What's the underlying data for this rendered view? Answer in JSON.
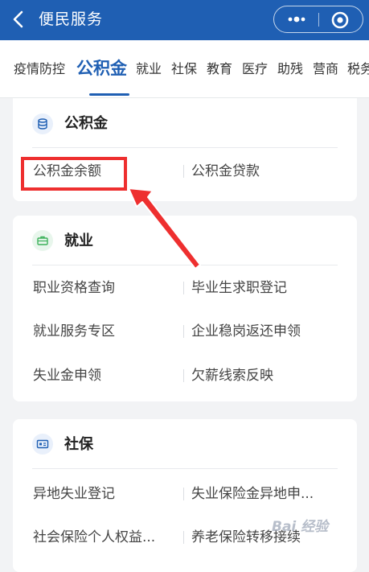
{
  "header": {
    "title": "便民服务",
    "color": "#1f5fb3"
  },
  "tabs": [
    {
      "label": "疫情防控",
      "active": false
    },
    {
      "label": "公积金",
      "active": true
    },
    {
      "label": "就业",
      "active": false
    },
    {
      "label": "社保",
      "active": false
    },
    {
      "label": "教育",
      "active": false
    },
    {
      "label": "医疗",
      "active": false
    },
    {
      "label": "助残",
      "active": false
    },
    {
      "label": "营商",
      "active": false
    },
    {
      "label": "税务",
      "active": false
    }
  ],
  "sections": [
    {
      "title": "公积金",
      "icon": "database-icon",
      "icon_color": "#1f5fb3",
      "items": [
        "公积金余额",
        "公积金贷款"
      ]
    },
    {
      "title": "就业",
      "icon": "briefcase-icon",
      "icon_color": "#3cb15a",
      "items": [
        "职业资格查询",
        "毕业生求职登记",
        "就业服务专区",
        "企业稳岗返还申领",
        "失业金申领",
        "欠薪线索反映"
      ]
    },
    {
      "title": "社保",
      "icon": "id-card-icon",
      "icon_color": "#1f5fb3",
      "items": [
        "异地失业登记",
        "失业保险金异地申...",
        "社会保险个人权益...",
        "养老保险转移接续"
      ]
    }
  ],
  "annotation": {
    "highlight_color": "#ee2f2f",
    "highlighted_item": "公积金余额"
  },
  "watermark": "Bai 经验"
}
